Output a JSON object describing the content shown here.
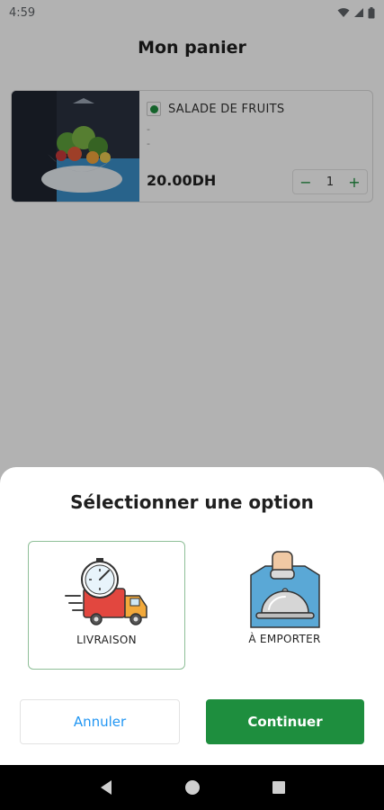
{
  "status_bar": {
    "time": "4:59"
  },
  "header": {
    "title": "Mon panier"
  },
  "cart": {
    "items": [
      {
        "name": "SALADE DE FRUITS",
        "line1": "-",
        "line2": "-",
        "price": "20.00DH",
        "quantity": "1",
        "minus": "−",
        "plus": "+"
      }
    ]
  },
  "sheet": {
    "title": "Sélectionner une option",
    "options": [
      {
        "label": "LIVRAISON",
        "icon": "delivery-truck-icon",
        "selected": true
      },
      {
        "label": "À EMPORTER",
        "icon": "cloche-takeaway-icon",
        "selected": false
      }
    ],
    "cancel_label": "Annuler",
    "continue_label": "Continuer"
  },
  "colors": {
    "accent_green": "#1e8e3e",
    "link_blue": "#2196f3",
    "selected_border": "#8fbf98"
  }
}
